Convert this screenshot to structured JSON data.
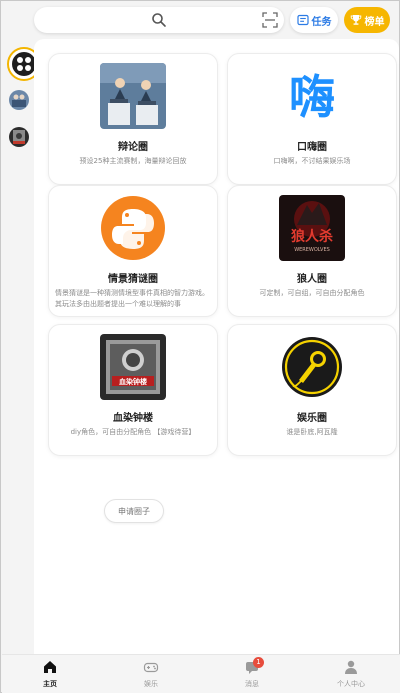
{
  "header": {
    "task_label": "任务",
    "rank_label": "榜单"
  },
  "cards": [
    {
      "title": "辩论圈",
      "desc": "预设25种主流赛制，海量辩论回放"
    },
    {
      "title": "口嗨圈",
      "desc": "口嗨啊，不讨结果娱乐场",
      "logo_text": "嗨"
    },
    {
      "title": "情景猜谜圈",
      "desc": "情景猜谜是一种猜测情境型事件真相的智力游戏。其玩法多由出题者提出一个难以理解的事"
    },
    {
      "title": "狼人圈",
      "desc": "可定制，可自组，可自由分配角色",
      "logo_text": "狼人杀",
      "logo_sub": "WEREWOLVES"
    },
    {
      "title": "血染钟楼",
      "desc": "diy角色，可自由分配角色 【游戏待营】",
      "logo_text": "血染钟楼"
    },
    {
      "title": "娱乐圈",
      "desc": "谁是卧底,阿瓦隆"
    }
  ],
  "apply_label": "申请圈子",
  "nav": [
    {
      "label": "主页"
    },
    {
      "label": "娱乐"
    },
    {
      "label": "消息",
      "badge": "1"
    },
    {
      "label": "个人中心"
    }
  ],
  "colors": {
    "accent": "#f6b600",
    "task_blue": "#2c7be5",
    "badge": "#e74c3c"
  }
}
